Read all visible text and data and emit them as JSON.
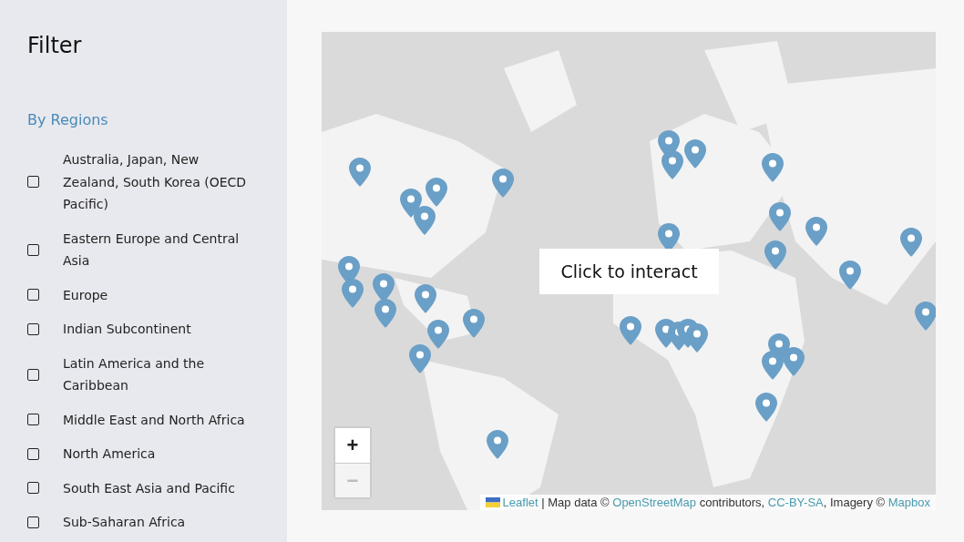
{
  "sidebar": {
    "title": "Filter",
    "section_title": "By Regions",
    "regions": [
      {
        "label": "Australia, Japan, New Zealand, South Korea (OECD Pacific)",
        "checked": false
      },
      {
        "label": "Eastern Europe and Central Asia",
        "checked": false
      },
      {
        "label": "Europe",
        "checked": false
      },
      {
        "label": "Indian Subcontinent",
        "checked": false
      },
      {
        "label": "Latin America and the Caribbean",
        "checked": false
      },
      {
        "label": "Middle East and North Africa",
        "checked": false
      },
      {
        "label": "North America",
        "checked": false
      },
      {
        "label": "South East Asia and Pacific",
        "checked": false
      },
      {
        "label": "Sub-Saharan Africa",
        "checked": false
      }
    ]
  },
  "map": {
    "overlay": "Click to interact",
    "zoom_controls": [
      {
        "label": "+",
        "disabled": false
      },
      {
        "label": "−",
        "disabled": true
      }
    ],
    "attribution": [
      {
        "kind": "link",
        "text": "Leaflet"
      },
      {
        "kind": "text",
        "text": " | Map data © "
      },
      {
        "kind": "link",
        "text": "OpenStreetMap"
      },
      {
        "kind": "text",
        "text": " contributors, "
      },
      {
        "kind": "link",
        "text": "CC-BY-SA"
      },
      {
        "kind": "text",
        "text": ", Imagery © "
      },
      {
        "kind": "link",
        "text": "Mapbox"
      }
    ]
  }
}
